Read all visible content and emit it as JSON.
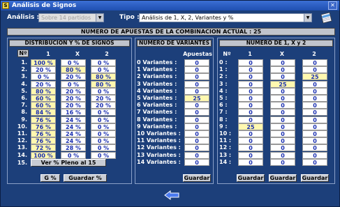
{
  "window": {
    "title": "Análisis de Signos"
  },
  "topbar": {
    "analisis_label": "Análisis :",
    "analisis_value": "Sobre 14 partidos",
    "tipo_label": "Tipo :",
    "tipo_value": "Análisis de 1, X, 2, Variantes y %"
  },
  "banner": "NUMERO DE APUESTAS DE LA COMBINACION ACTUAL : 25",
  "dist": {
    "title": "DISTRIBUCION Y % DE SIGNOS",
    "headers": [
      "Nº",
      "1",
      "X",
      "2"
    ],
    "rows": [
      {
        "n": "1.",
        "c1": "100 %",
        "cx": "0 %",
        "c2": "0 %",
        "h1": true,
        "hx": false,
        "h2": false
      },
      {
        "n": "2.",
        "c1": "20 %",
        "cx": "80 %",
        "c2": "0 %",
        "h1": false,
        "hx": true,
        "h2": false
      },
      {
        "n": "3.",
        "c1": "0 %",
        "cx": "20 %",
        "c2": "80 %",
        "h1": false,
        "hx": false,
        "h2": true
      },
      {
        "n": "4.",
        "c1": "20 %",
        "cx": "0 %",
        "c2": "80 %",
        "h1": false,
        "hx": false,
        "h2": true
      },
      {
        "n": "5.",
        "c1": "80 %",
        "cx": "20 %",
        "c2": "0 %",
        "h1": true,
        "hx": false,
        "h2": false
      },
      {
        "n": "6.",
        "c1": "60 %",
        "cx": "20 %",
        "c2": "20 %",
        "h1": true,
        "hx": false,
        "h2": false
      },
      {
        "n": "7.",
        "c1": "60 %",
        "cx": "20 %",
        "c2": "20 %",
        "h1": true,
        "hx": false,
        "h2": false
      },
      {
        "n": "8.",
        "c1": "84 %",
        "cx": "16 %",
        "c2": "0 %",
        "h1": true,
        "hx": false,
        "h2": false
      },
      {
        "n": "9.",
        "c1": "76 %",
        "cx": "24 %",
        "c2": "0 %",
        "h1": true,
        "hx": false,
        "h2": false
      },
      {
        "n": "10.",
        "c1": "76 %",
        "cx": "24 %",
        "c2": "0 %",
        "h1": true,
        "hx": false,
        "h2": false
      },
      {
        "n": "11.",
        "c1": "76 %",
        "cx": "24 %",
        "c2": "0 %",
        "h1": true,
        "hx": false,
        "h2": false
      },
      {
        "n": "12.",
        "c1": "76 %",
        "cx": "24 %",
        "c2": "0 %",
        "h1": true,
        "hx": false,
        "h2": false
      },
      {
        "n": "13.",
        "c1": "72 %",
        "cx": "28 %",
        "c2": "0 %",
        "h1": true,
        "hx": false,
        "h2": false
      },
      {
        "n": "14.",
        "c1": "100 %",
        "cx": "0 %",
        "c2": "0 %",
        "h1": true,
        "hx": false,
        "h2": false
      }
    ],
    "row15_label": "15.",
    "pleno_button": "Ver % Pleno al 15",
    "g_button": "G %",
    "save_button": "Guardar %"
  },
  "variantes": {
    "title": "NUMERO DE VARIANTES",
    "col_header": "Apuestas",
    "rows": [
      {
        "label": "0 Variantes :",
        "v": "0",
        "hi": false
      },
      {
        "label": "1 Variantes :",
        "v": "0",
        "hi": false
      },
      {
        "label": "2 Variantes :",
        "v": "0",
        "hi": false
      },
      {
        "label": "3 Variantes :",
        "v": "0",
        "hi": false
      },
      {
        "label": "4 Variantes :",
        "v": "0",
        "hi": false
      },
      {
        "label": "5 Variantes :",
        "v": "25",
        "hi": true
      },
      {
        "label": "6 Variantes :",
        "v": "0",
        "hi": false
      },
      {
        "label": "7 Variantes :",
        "v": "0",
        "hi": false
      },
      {
        "label": "8 Variantes :",
        "v": "0",
        "hi": false
      },
      {
        "label": "9 Variantes :",
        "v": "0",
        "hi": false
      },
      {
        "label": "10 Variantes :",
        "v": "0",
        "hi": false
      },
      {
        "label": "11 Variantes :",
        "v": "0",
        "hi": false
      },
      {
        "label": "12 Variantes :",
        "v": "0",
        "hi": false
      },
      {
        "label": "13 Variantes :",
        "v": "0",
        "hi": false
      },
      {
        "label": "14 Variantes :",
        "v": "0",
        "hi": false
      }
    ],
    "save_button": "Guardar"
  },
  "num1x2": {
    "title": "NUMERO DE 1, X y 2",
    "headers": [
      "Nº",
      "1",
      "X",
      "2"
    ],
    "rows": [
      {
        "n": "0 :",
        "c1": "0",
        "cx": "0",
        "c2": "0",
        "h1": false,
        "hx": false,
        "h2": false
      },
      {
        "n": "1 :",
        "c1": "0",
        "cx": "0",
        "c2": "0",
        "h1": false,
        "hx": false,
        "h2": false
      },
      {
        "n": "2 :",
        "c1": "0",
        "cx": "0",
        "c2": "25",
        "h1": false,
        "hx": false,
        "h2": true
      },
      {
        "n": "3 :",
        "c1": "0",
        "cx": "25",
        "c2": "0",
        "h1": false,
        "hx": true,
        "h2": false
      },
      {
        "n": "4 :",
        "c1": "0",
        "cx": "0",
        "c2": "0",
        "h1": false,
        "hx": false,
        "h2": false
      },
      {
        "n": "5 :",
        "c1": "0",
        "cx": "0",
        "c2": "0",
        "h1": false,
        "hx": false,
        "h2": false
      },
      {
        "n": "6 :",
        "c1": "0",
        "cx": "0",
        "c2": "0",
        "h1": false,
        "hx": false,
        "h2": false
      },
      {
        "n": "7 :",
        "c1": "0",
        "cx": "0",
        "c2": "0",
        "h1": false,
        "hx": false,
        "h2": false
      },
      {
        "n": "8 :",
        "c1": "0",
        "cx": "0",
        "c2": "0",
        "h1": false,
        "hx": false,
        "h2": false
      },
      {
        "n": "9 :",
        "c1": "25",
        "cx": "0",
        "c2": "0",
        "h1": true,
        "hx": false,
        "h2": false
      },
      {
        "n": "10 :",
        "c1": "0",
        "cx": "0",
        "c2": "0",
        "h1": false,
        "hx": false,
        "h2": false
      },
      {
        "n": "11 :",
        "c1": "0",
        "cx": "0",
        "c2": "0",
        "h1": false,
        "hx": false,
        "h2": false
      },
      {
        "n": "12 :",
        "c1": "0",
        "cx": "0",
        "c2": "0",
        "h1": false,
        "hx": false,
        "h2": false
      },
      {
        "n": "13 :",
        "c1": "0",
        "cx": "0",
        "c2": "0",
        "h1": false,
        "hx": false,
        "h2": false
      },
      {
        "n": "14 :",
        "c1": "0",
        "cx": "0",
        "c2": "0",
        "h1": false,
        "hx": false,
        "h2": false
      }
    ],
    "save_buttons": [
      "Guardar",
      "Guardar",
      "Guardar"
    ]
  },
  "icons": {
    "app": "app-icon",
    "notebook": "notebook-icon",
    "back": "back-arrow-icon"
  }
}
